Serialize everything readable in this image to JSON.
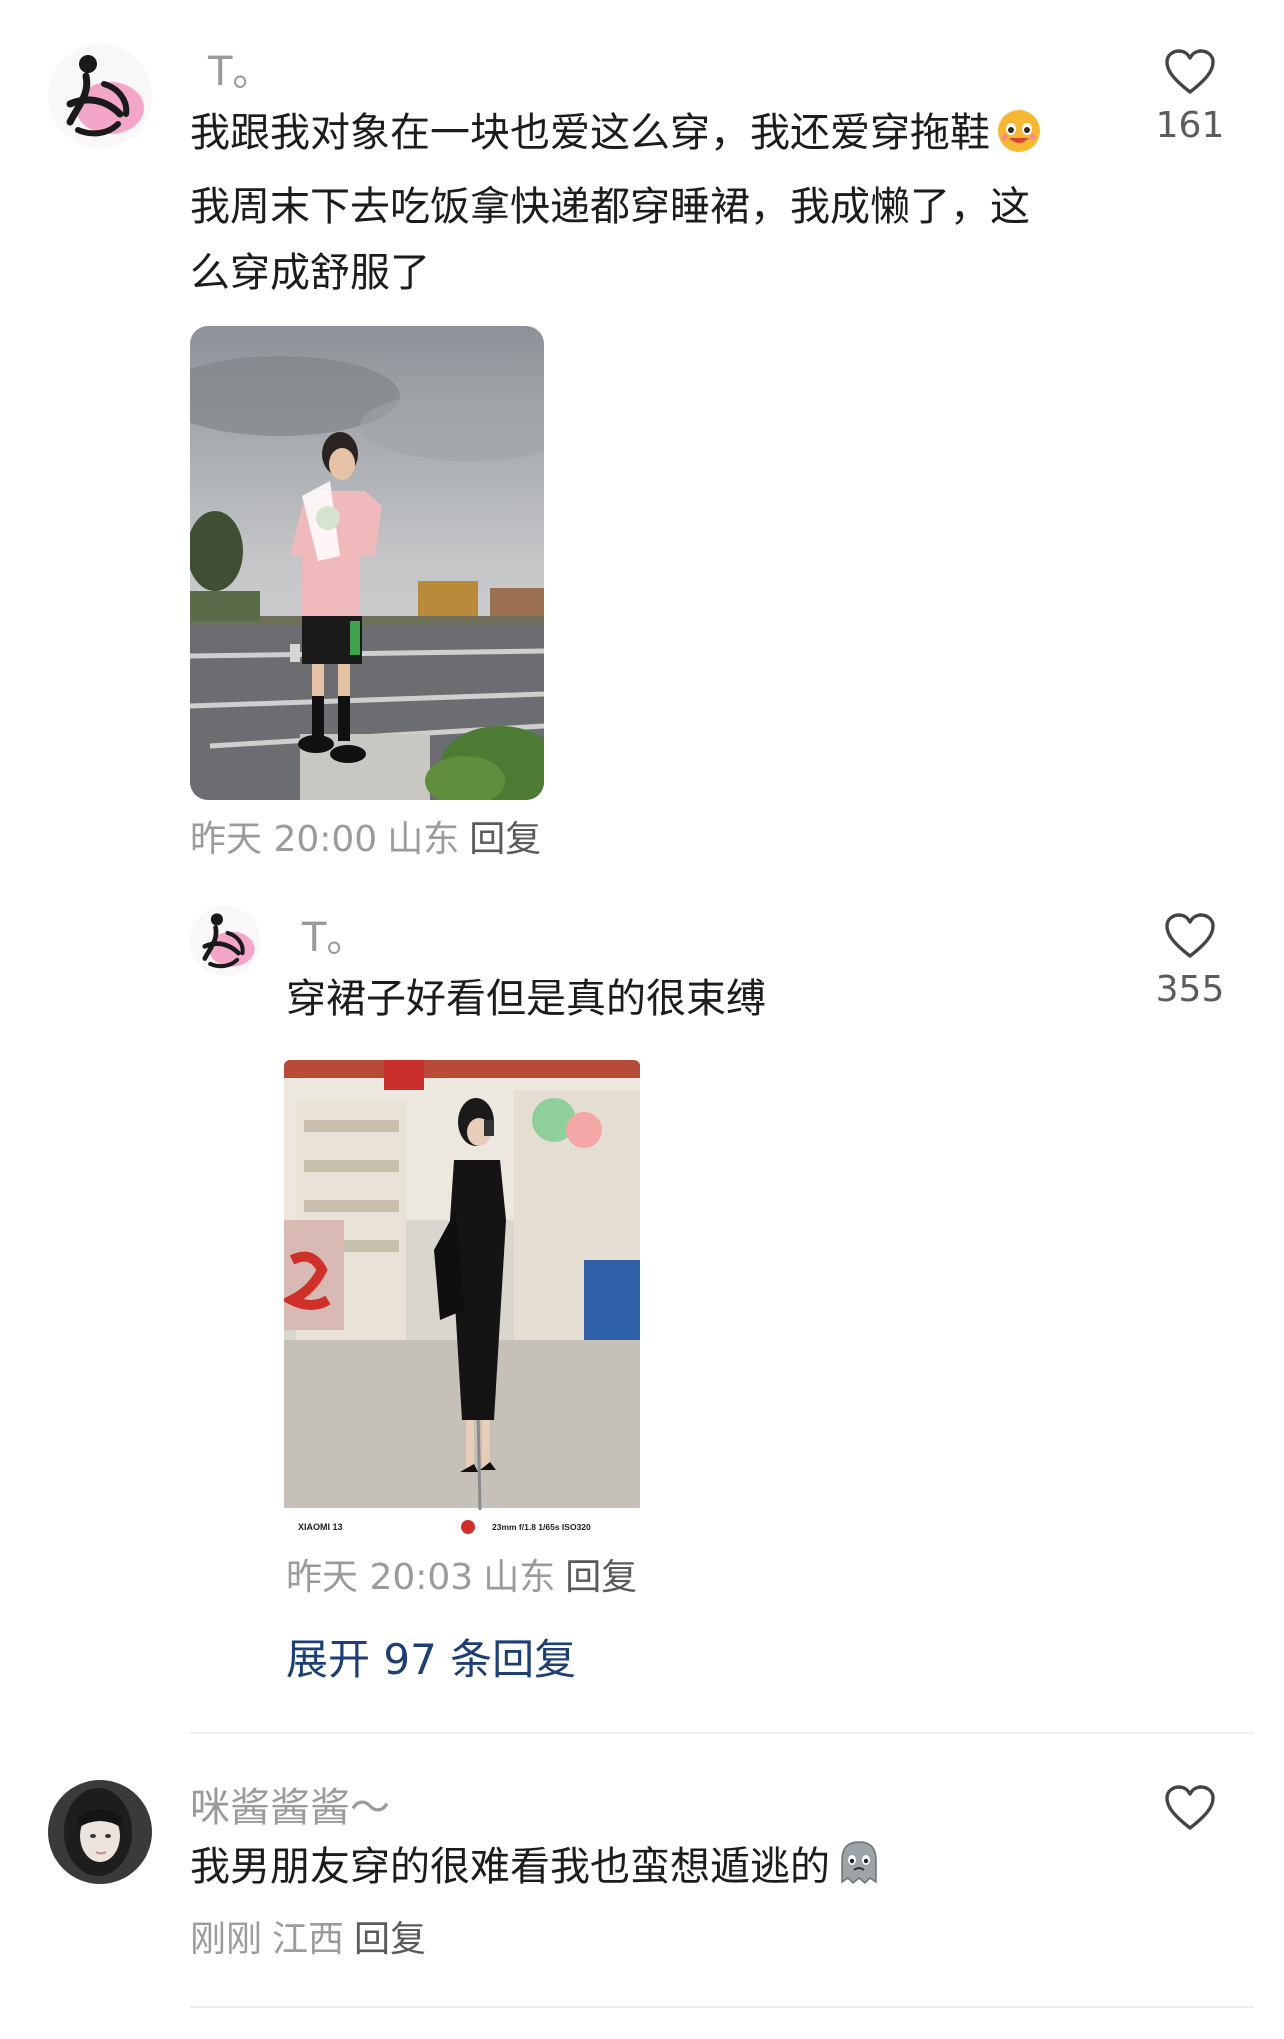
{
  "comments": [
    {
      "username": "T。",
      "text_line1": "我跟我对象在一块也爱这么穿，我还爱穿拖鞋",
      "text_line1_emoji": "laughing-face-emoji",
      "text_line2": "我周末下去吃饭拿快递都穿睡裙，我成懒了，这",
      "text_line3": "么穿成舒服了",
      "like_count": "161",
      "time": "昨天 20:00",
      "location": "山东",
      "reply_label": "回复",
      "image": "photo-girl-pink-shirt-on-street"
    },
    {
      "username": "T。",
      "text": "穿裙子好看但是真的很束缚",
      "like_count": "355",
      "time": "昨天 20:03",
      "location": "山东",
      "reply_label": "回复",
      "image": "photo-girl-black-dress-mirror-selfie",
      "photo_caption_left": "XIAOMI 13",
      "photo_caption_right": "23mm f/1.8 1/65s ISO320"
    },
    {
      "username": "咪酱酱酱～",
      "text": "我男朋友穿的很难看我也蛮想遁逃的",
      "text_emoji": "ghost-pout-emoji",
      "like_count": "",
      "time": "刚刚",
      "location": "江西",
      "reply_label": "回复"
    }
  ],
  "expand_replies": "展开 97 条回复",
  "colors": {
    "link": "#1e3f73",
    "meta": "#9b9b9b",
    "text": "#1c1c1c"
  }
}
